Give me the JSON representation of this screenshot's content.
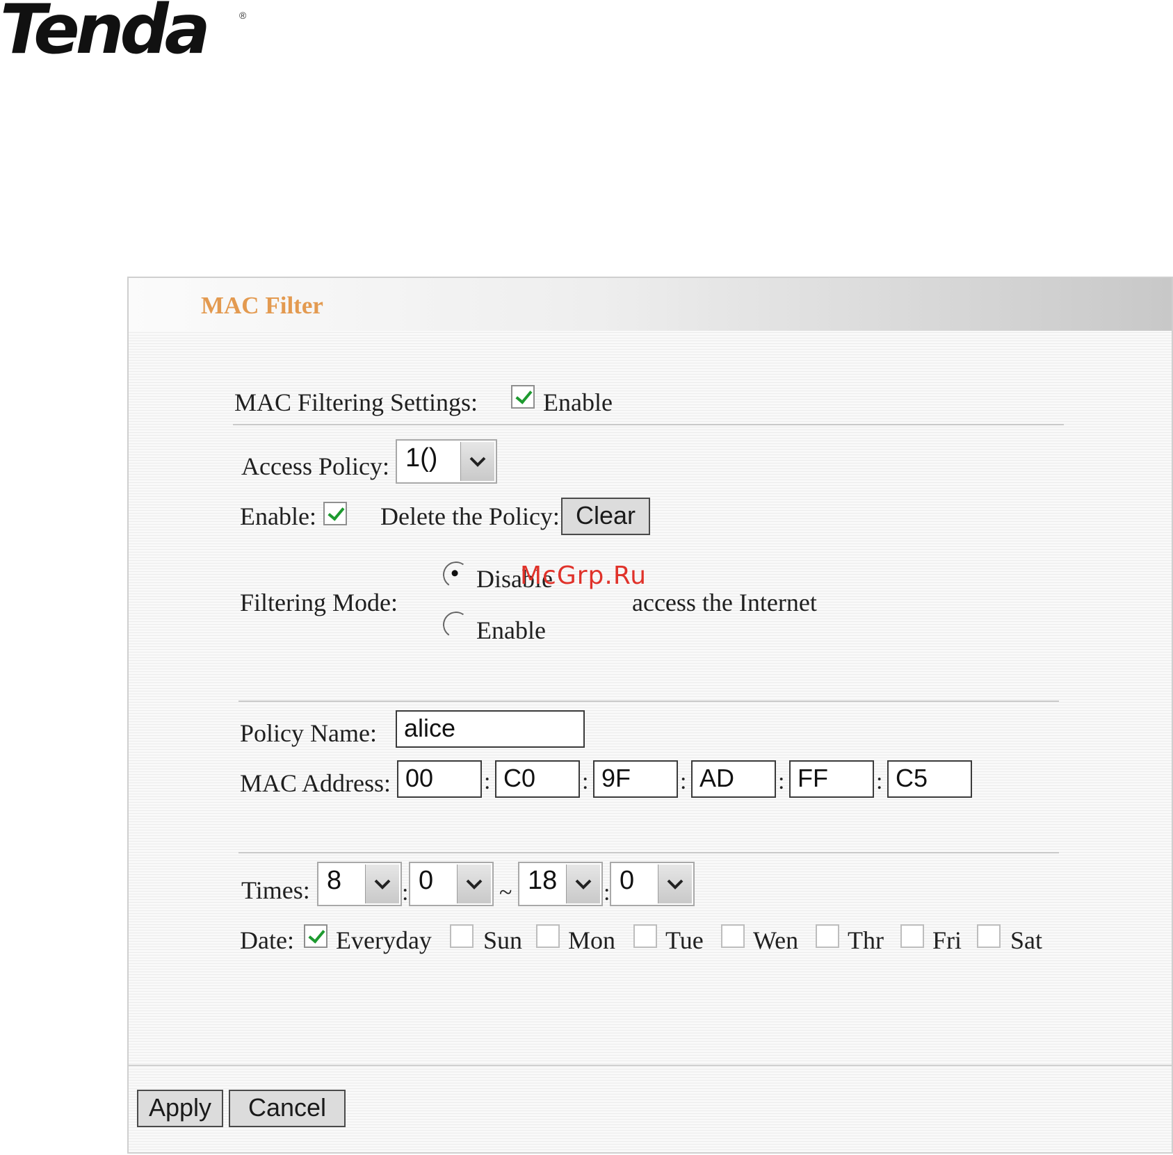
{
  "brand": {
    "logo_text": "Tenda",
    "registered_mark": "®"
  },
  "panel": {
    "title": "MAC Filter"
  },
  "mac_filtering": {
    "label": "MAC Filtering Settings:",
    "enable_label": "Enable",
    "enabled": true
  },
  "access_policy": {
    "label": "Access Policy:",
    "selected": "1()"
  },
  "policy_enable": {
    "label": "Enable:",
    "enabled": true
  },
  "delete_policy": {
    "label": "Delete the Policy:",
    "button": "Clear"
  },
  "filtering_mode": {
    "label": "Filtering Mode:",
    "options": [
      {
        "label": "Disable",
        "selected": true
      },
      {
        "label": "Enable",
        "selected": false
      }
    ],
    "suffix": "access the Internet"
  },
  "policy_name": {
    "label": "Policy Name:",
    "value": "alice"
  },
  "mac_address": {
    "label": "MAC Address:",
    "octets": [
      "00",
      "C0",
      "9F",
      "AD",
      "FF",
      "C5"
    ],
    "separator": ":"
  },
  "times": {
    "label": "Times:",
    "start_hour": "8",
    "start_minute": "0",
    "range_sep": "~",
    "end_hour": "18",
    "end_minute": "0",
    "separator": ":"
  },
  "date": {
    "label": "Date:",
    "days": [
      {
        "label": "Everyday",
        "checked": true
      },
      {
        "label": "Sun",
        "checked": false
      },
      {
        "label": "Mon",
        "checked": false
      },
      {
        "label": "Tue",
        "checked": false
      },
      {
        "label": "Wen",
        "checked": false
      },
      {
        "label": "Thr",
        "checked": false
      },
      {
        "label": "Fri",
        "checked": false
      },
      {
        "label": "Sat",
        "checked": false
      }
    ]
  },
  "actions": {
    "apply": "Apply",
    "cancel": "Cancel"
  },
  "watermark": "McGrp.Ru",
  "colors": {
    "title": "#e39a50",
    "check": "#1d9a2f",
    "watermark": "#e0322a"
  }
}
